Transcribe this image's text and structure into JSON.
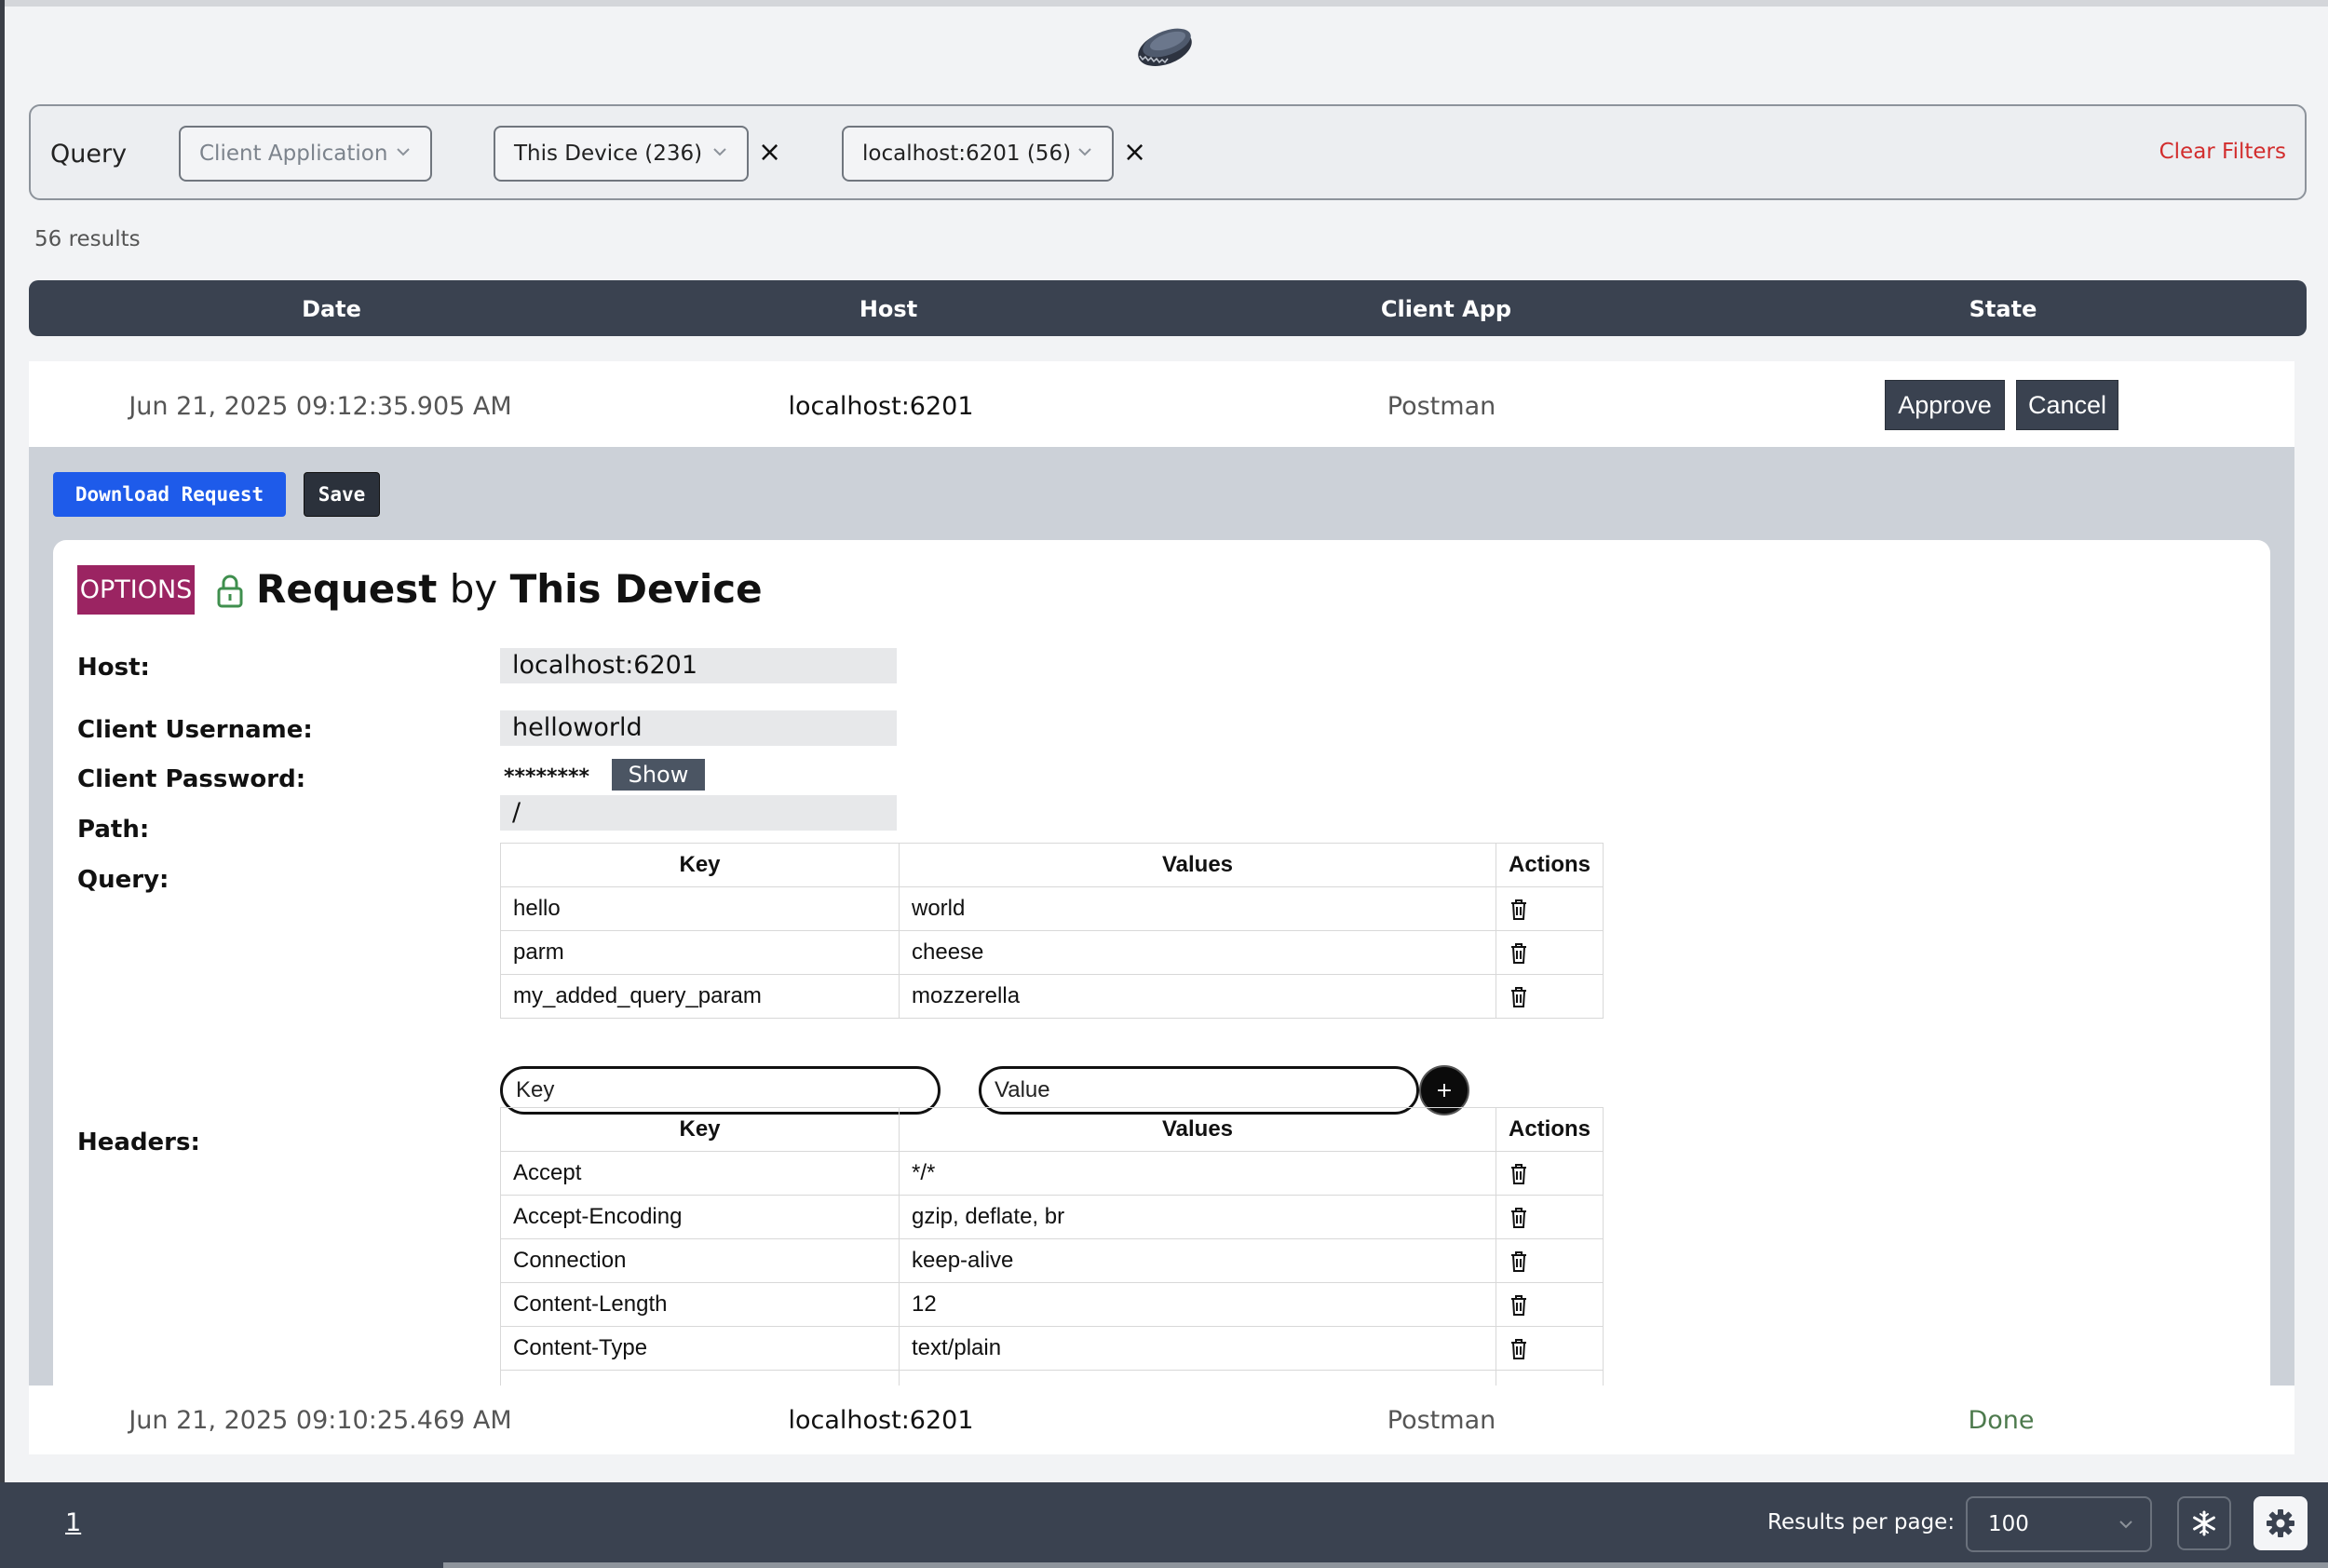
{
  "query": {
    "label": "Query",
    "filters": [
      {
        "label": "Client Application",
        "placeholder": true,
        "removable": false
      },
      {
        "label": "This Device (236)",
        "placeholder": false,
        "removable": true
      },
      {
        "label": "localhost:6201 (56)",
        "placeholder": false,
        "removable": true
      }
    ],
    "remove_symbol": "×",
    "clear_label": "Clear Filters"
  },
  "results_count": "56 results",
  "table": {
    "headers": [
      "Date",
      "Host",
      "Client App",
      "State"
    ],
    "rows": [
      {
        "date": "Jun 21, 2025 09:12:35.905 AM",
        "host": "localhost:6201",
        "client_app": "Postman",
        "approve_label": "Approve",
        "cancel_label": "Cancel"
      },
      {
        "date": "Jun 21, 2025 09:10:25.469 AM",
        "host": "localhost:6201",
        "client_app": "Postman",
        "state": "Done"
      }
    ]
  },
  "detail": {
    "download_label": "Download Request",
    "save_label": "Save",
    "method": "OPTIONS",
    "title_word": "Request",
    "title_by": "by",
    "title_device": "This Device",
    "host_label": "Host:",
    "host_value": "localhost:6201",
    "username_label": "Client Username:",
    "username_value": "helloworld",
    "password_label": "Client Password:",
    "password_masked": "********",
    "show_label": "Show",
    "path_label": "Path:",
    "path_value": "/",
    "query_label": "Query:",
    "query_table": {
      "headers": [
        "Key",
        "Values",
        "Actions"
      ],
      "rows": [
        {
          "key": "hello",
          "value": "world"
        },
        {
          "key": "parm",
          "value": "cheese"
        },
        {
          "key": "my_added_query_param",
          "value": "mozzerella"
        }
      ]
    },
    "key_placeholder": "Key",
    "value_placeholder": "Value",
    "add_symbol": "+",
    "headers_label": "Headers:",
    "headers_table": {
      "headers": [
        "Key",
        "Values",
        "Actions"
      ],
      "rows": [
        {
          "key": "Accept",
          "value": "*/*"
        },
        {
          "key": "Accept-Encoding",
          "value": "gzip, deflate, br"
        },
        {
          "key": "Connection",
          "value": "keep-alive"
        },
        {
          "key": "Content-Length",
          "value": "12"
        },
        {
          "key": "Content-Type",
          "value": "text/plain"
        }
      ]
    }
  },
  "footer": {
    "page": "1",
    "results_per_page_label": "Results per page:",
    "results_per_page_value": "100"
  },
  "icons": {
    "logo": "bottle-cap-icon",
    "lock": "lock-open-icon",
    "trash": "trash-icon",
    "snow": "snowflake-icon",
    "gear": "gear-icon"
  },
  "colors": {
    "dark": "#3a4250",
    "method_badge": "#9b2462",
    "download": "#1e5bea",
    "clear_filters": "#d22d2d",
    "done": "#4d7a4d"
  }
}
